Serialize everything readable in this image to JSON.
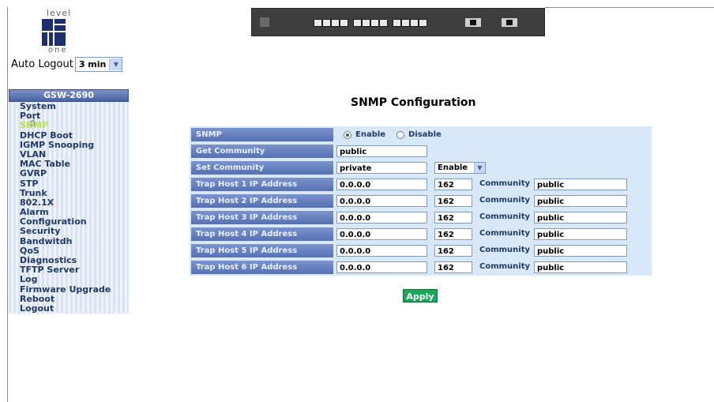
{
  "logo": {
    "top_text": "level",
    "bottom_text": "one"
  },
  "autologout": {
    "label": "Auto Logout",
    "value": "3 min"
  },
  "sidebar": {
    "title": "GSW-2690",
    "items": [
      "System",
      "Port",
      "SNMP",
      "DHCP Boot",
      "IGMP Snooping",
      "VLAN",
      "MAC Table",
      "GVRP",
      "STP",
      "Trunk",
      "802.1X",
      "Alarm",
      "Configuration",
      "Security",
      "Bandwitdh",
      "QoS",
      "Diagnostics",
      "TFTP Server",
      "Log",
      "Firmware Upgrade",
      "Reboot",
      "Logout"
    ]
  },
  "page": {
    "title": "SNMP Configuration"
  },
  "snmp": {
    "label": "SNMP",
    "enable_label": "Enable",
    "disable_label": "Disable",
    "selected": "Enable"
  },
  "get_community": {
    "label": "Get Community",
    "value": "public"
  },
  "set_community": {
    "label": "Set Community",
    "value": "private",
    "status": "Enable"
  },
  "trap_hosts": [
    {
      "label": "Trap Host 1 IP Address",
      "ip": "0.0.0.0",
      "port": "162",
      "community_label": "Community",
      "community": "public"
    },
    {
      "label": "Trap Host 2 IP Address",
      "ip": "0.0.0.0",
      "port": "162",
      "community_label": "Community",
      "community": "public"
    },
    {
      "label": "Trap Host 3 IP Address",
      "ip": "0.0.0.0",
      "port": "162",
      "community_label": "Community",
      "community": "public"
    },
    {
      "label": "Trap Host 4 IP Address",
      "ip": "0.0.0.0",
      "port": "162",
      "community_label": "Community",
      "community": "public"
    },
    {
      "label": "Trap Host 5 IP Address",
      "ip": "0.0.0.0",
      "port": "162",
      "community_label": "Community",
      "community": "public"
    },
    {
      "label": "Trap Host 6 IP Address",
      "ip": "0.0.0.0",
      "port": "162",
      "community_label": "Community",
      "community": "public"
    }
  ],
  "apply_label": "Apply",
  "colors": {
    "accent": "#5670b3",
    "apply": "#1aa65b",
    "panel": "#d9e8f8"
  }
}
